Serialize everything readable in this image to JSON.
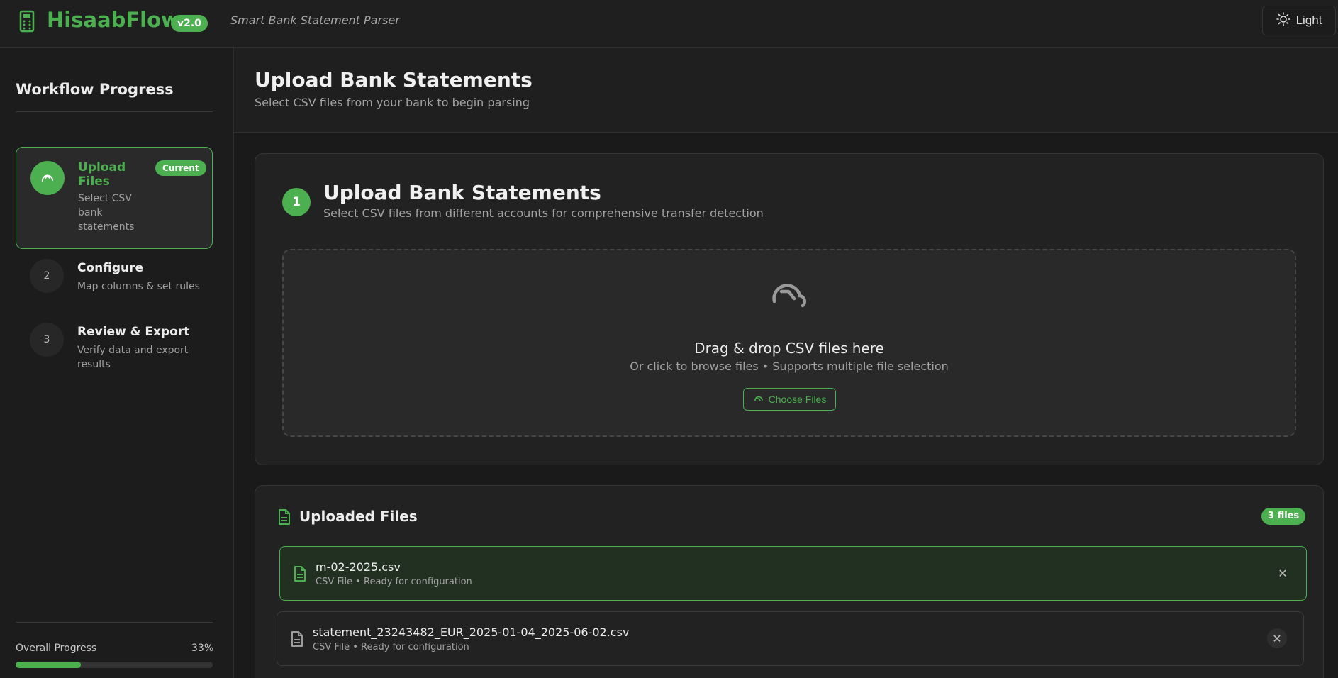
{
  "header": {
    "brand": "HisaabFlow",
    "version": "v2.0",
    "tagline": "Smart Bank Statement Parser",
    "theme_label": "Light"
  },
  "sidebar": {
    "title": "Workflow Progress",
    "steps": [
      {
        "number": "1",
        "title": "Upload Files",
        "desc": "Select CSV bank statements",
        "badge": "Current"
      },
      {
        "number": "2",
        "title": "Configure",
        "desc": "Map columns & set rules"
      },
      {
        "number": "3",
        "title": "Review & Export",
        "desc": "Verify data and export results"
      }
    ],
    "progress_label": "Overall Progress",
    "progress_value": "33%",
    "progress_fraction": 0.33
  },
  "main": {
    "title": "Upload Bank Statements",
    "subtitle": "Select CSV files from your bank to begin parsing",
    "upload_card": {
      "step_number": "1",
      "title": "Upload Bank Statements",
      "subtitle": "Select CSV files from different accounts for comprehensive transfer detection",
      "drop_title": "Drag & drop CSV files here",
      "drop_subtitle": "Or click to browse files • Supports multiple file selection",
      "choose_label": "Choose Files"
    },
    "uploaded": {
      "title": "Uploaded Files",
      "count_badge": "3 files",
      "files": [
        {
          "name": "m-02-2025.csv",
          "meta": "CSV File • Ready for configuration"
        },
        {
          "name": "statement_23243482_EUR_2025-01-04_2025-06-02.csv",
          "meta": "CSV File • Ready for configuration"
        }
      ]
    }
  },
  "colors": {
    "accent": "#4caf50",
    "background": "#1a1a1a",
    "card": "#222222"
  }
}
